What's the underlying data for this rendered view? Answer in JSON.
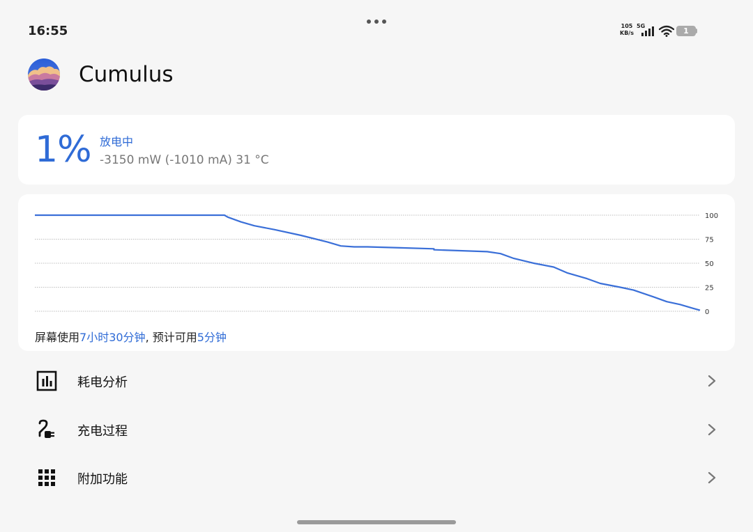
{
  "status_bar": {
    "time": "16:55",
    "net_speed_value": "105",
    "net_speed_unit": "KB/s",
    "network_type": "5G",
    "battery_level": "1"
  },
  "app": {
    "title": "Cumulus",
    "logo_icon": "cumulus-logo-icon"
  },
  "battery_status": {
    "percent": "1%",
    "state": "放电中",
    "detail": "-3150 mW (-1010 mA) 31 °C"
  },
  "usage": {
    "prefix": "屏幕使用",
    "screen_time": "7小时30分钟",
    "separator": ", 预计可用",
    "remaining": "5分钟"
  },
  "chart_data": {
    "type": "line",
    "x": [
      0,
      0.285,
      0.29,
      0.31,
      0.33,
      0.36,
      0.4,
      0.44,
      0.46,
      0.48,
      0.5,
      0.55,
      0.6,
      0.6,
      0.68,
      0.7,
      0.72,
      0.75,
      0.78,
      0.8,
      0.83,
      0.85,
      0.88,
      0.9,
      0.93,
      0.95,
      0.97,
      0.99,
      1.0
    ],
    "values": [
      100,
      100,
      98,
      93,
      89,
      85,
      79,
      72,
      68,
      67,
      67,
      66,
      65,
      64,
      62,
      60,
      55,
      50,
      46,
      40,
      34,
      29,
      25,
      22,
      15,
      10,
      7,
      3,
      1
    ],
    "xlim": [
      0,
      1
    ],
    "ylim": [
      0,
      100
    ],
    "y_ticks": [
      "0",
      "25",
      "50",
      "75",
      "100"
    ],
    "grid": true,
    "line_color": "#3a6fd8",
    "grid_color": "#bdbdbd"
  },
  "menu": [
    {
      "label": "耗电分析",
      "icon": "bar-chart-icon"
    },
    {
      "label": "充电过程",
      "icon": "charging-plug-icon"
    },
    {
      "label": "附加功能",
      "icon": "grid-icon"
    }
  ],
  "colors": {
    "accent": "#2f6bd6",
    "background": "#f6f6f6",
    "card": "#ffffff"
  }
}
